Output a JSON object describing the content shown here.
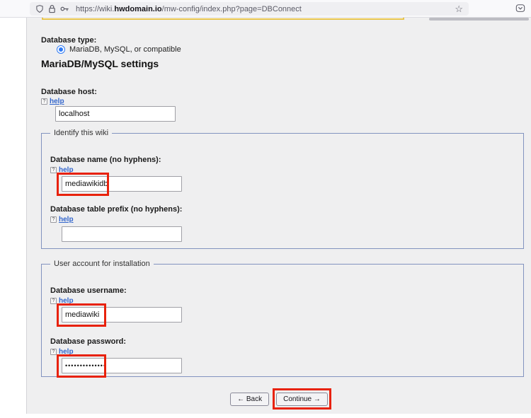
{
  "browser": {
    "url": {
      "prefix": "https://wiki.",
      "domain": "hwdomain.io",
      "path": "/mw-config/index.php?page=DBConnect"
    },
    "icons": {
      "star": "☆"
    }
  },
  "installer": {
    "help_label": "help",
    "help_icon_glyph": "?",
    "db_type": {
      "label": "Database type:",
      "selected_option": "MariaDB, MySQL, or compatible"
    },
    "heading": "MariaDB/MySQL settings",
    "host": {
      "label": "Database host:",
      "value": "localhost"
    },
    "identify": {
      "legend": "Identify this wiki",
      "db_name": {
        "label": "Database name (no hyphens):",
        "value": "mediawikidb"
      },
      "db_prefix": {
        "label": "Database table prefix (no hyphens):",
        "value": ""
      }
    },
    "account": {
      "legend": "User account for installation",
      "username": {
        "label": "Database username:",
        "value": "mediawiki"
      },
      "password": {
        "label": "Database password:",
        "value": "••••••••••••••"
      }
    },
    "buttons": {
      "back": "← Back",
      "continue": "Continue →"
    }
  },
  "colors": {
    "annotation_red": "#e8220c",
    "fieldset_border": "#8293bf",
    "link_blue": "#3366cc",
    "warning_border": "#e7c44d",
    "page_background": "#efeff0"
  }
}
